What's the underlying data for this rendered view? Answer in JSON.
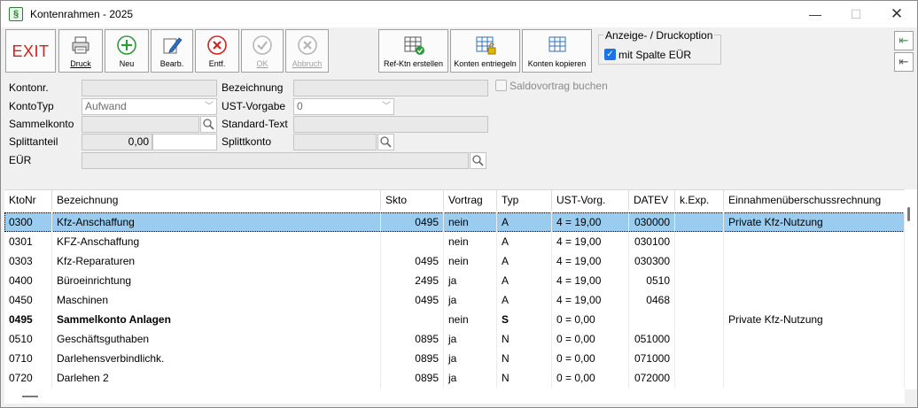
{
  "window": {
    "app_icon": "§",
    "title": "Kontenrahmen - 2025",
    "minimize": "—",
    "maximize": "☐",
    "close": "✕"
  },
  "toolbar": {
    "exit": "EXIT",
    "druck": "Druck",
    "neu": "Neu",
    "bearb": "Bearb.",
    "entf": "Entf.",
    "ok": "OK",
    "abbruch": "Abbruch",
    "refktn": "Ref-Ktn erstellen",
    "entriegeln": "Konten entriegeln",
    "kopieren": "Konten kopieren",
    "option_title": "Anzeige- / Druckoption",
    "option_label": "mit Spalte EÜR",
    "option_checked": true,
    "nav_first": "⇤",
    "nav_prev": "⇤"
  },
  "form": {
    "kontonr_label": "Kontonr.",
    "kontonr_value": "",
    "bezeichnung_label": "Bezeichnung",
    "bezeichnung_value": "",
    "saldovortrag_label": "Saldovortrag buchen",
    "kontotyp_label": "KontoTyp",
    "kontotyp_value": "Aufwand",
    "ust_label": "UST-Vorgabe",
    "ust_value": "0",
    "sammelkonto_label": "Sammelkonto",
    "sammelkonto_value": "",
    "standardtext_label": "Standard-Text",
    "standardtext_value": "",
    "splittanteil_label": "Splittanteil",
    "splittanteil_value": "0,00",
    "splittkonto_label": "Splittkonto",
    "splittkonto_value": "",
    "eur_label": "EÜR",
    "eur_value": ""
  },
  "grid": {
    "columns": [
      "KtoNr",
      "Bezeichnung",
      "Skto",
      "Vortrag",
      "Typ",
      "UST-Vorg.",
      "DATEV",
      "k.Exp.",
      "Einnahmenüberschussrechnung"
    ],
    "rows": [
      {
        "ktonr": "0300",
        "bez": "Kfz-Anschaffung",
        "skto": "0495",
        "vortrag": "nein",
        "typ": "A",
        "ust": "4 = 19,00",
        "datev": "030000",
        "kexp": "",
        "eur": "Private Kfz-Nutzung",
        "selected": true,
        "bold": false
      },
      {
        "ktonr": "0301",
        "bez": "KFZ-Anschaffung",
        "skto": "",
        "vortrag": "nein",
        "typ": "A",
        "ust": "4 = 19,00",
        "datev": "030100",
        "kexp": "",
        "eur": "",
        "selected": false,
        "bold": false
      },
      {
        "ktonr": "0303",
        "bez": "Kfz-Reparaturen",
        "skto": "0495",
        "vortrag": "nein",
        "typ": "A",
        "ust": "4 = 19,00",
        "datev": "030300",
        "kexp": "",
        "eur": "",
        "selected": false,
        "bold": false
      },
      {
        "ktonr": "0400",
        "bez": "Büroeinrichtung",
        "skto": "2495",
        "vortrag": "ja",
        "typ": "A",
        "ust": "4 = 19,00",
        "datev": "0510",
        "kexp": "",
        "eur": "",
        "selected": false,
        "bold": false
      },
      {
        "ktonr": "0450",
        "bez": "Maschinen",
        "skto": "0495",
        "vortrag": "ja",
        "typ": "A",
        "ust": "4 = 19,00",
        "datev": "0468",
        "kexp": "",
        "eur": "",
        "selected": false,
        "bold": false
      },
      {
        "ktonr": "0495",
        "bez": "Sammelkonto Anlagen",
        "skto": "",
        "vortrag": "nein",
        "typ": "S",
        "ust": "0 = 0,00",
        "datev": "",
        "kexp": "",
        "eur": "Private Kfz-Nutzung",
        "selected": false,
        "bold": true
      },
      {
        "ktonr": "0510",
        "bez": "Geschäftsguthaben",
        "skto": "0895",
        "vortrag": "ja",
        "typ": "N",
        "ust": "0 = 0,00",
        "datev": "051000",
        "kexp": "",
        "eur": "",
        "selected": false,
        "bold": false
      },
      {
        "ktonr": "0710",
        "bez": "Darlehensverbindlichk.",
        "skto": "0895",
        "vortrag": "ja",
        "typ": "N",
        "ust": "0 = 0,00",
        "datev": "071000",
        "kexp": "",
        "eur": "",
        "selected": false,
        "bold": false
      },
      {
        "ktonr": "0720",
        "bez": "Darlehen 2",
        "skto": "0895",
        "vortrag": "ja",
        "typ": "N",
        "ust": "0 = 0,00",
        "datev": "072000",
        "kexp": "",
        "eur": "",
        "selected": false,
        "bold": false
      }
    ]
  }
}
